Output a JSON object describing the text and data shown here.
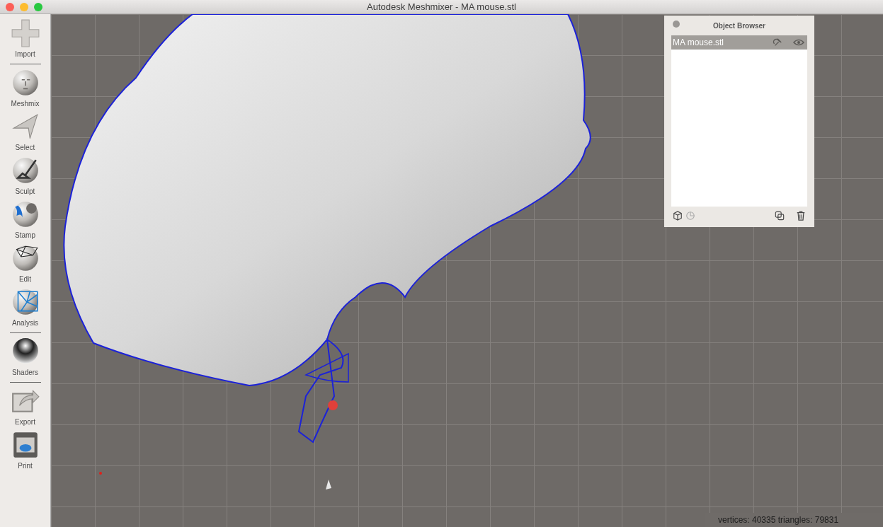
{
  "window": {
    "title": "Autodesk Meshmixer - MA mouse.stl"
  },
  "toolbar": [
    {
      "kind": "tool",
      "label": "Import"
    },
    {
      "kind": "separator"
    },
    {
      "kind": "tool",
      "label": "Meshmix"
    },
    {
      "kind": "tool",
      "label": "Select"
    },
    {
      "kind": "tool",
      "label": "Sculpt"
    },
    {
      "kind": "tool",
      "label": "Stamp"
    },
    {
      "kind": "tool",
      "label": "Edit"
    },
    {
      "kind": "tool",
      "label": "Analysis"
    },
    {
      "kind": "separator"
    },
    {
      "kind": "tool",
      "label": "Shaders"
    },
    {
      "kind": "separator"
    },
    {
      "kind": "tool",
      "label": "Export"
    },
    {
      "kind": "tool",
      "label": "Print"
    }
  ],
  "object_browser": {
    "title": "Object Browser",
    "items": [
      {
        "name": "MA mouse.stl",
        "selected": true
      }
    ]
  },
  "status_bar": "vertices: 40335 triangles: 79831"
}
